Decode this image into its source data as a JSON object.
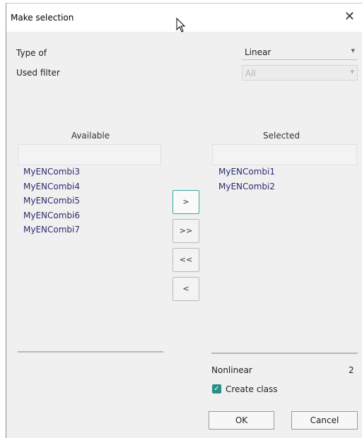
{
  "window": {
    "title": "Make selection",
    "close_glyph": "✕"
  },
  "form": {
    "type_label": "Type of",
    "type_value": "Linear",
    "filter_label": "Used filter",
    "filter_value": "All"
  },
  "available": {
    "header": "Available",
    "items": [
      "MyENCombi3",
      "MyENCombi4",
      "MyENCombi5",
      "MyENCombi6",
      "MyENCombi7"
    ]
  },
  "selected": {
    "header": "Selected",
    "items": [
      "MyENCombi1",
      "MyENCombi2"
    ]
  },
  "transfer": {
    "add_one": ">",
    "add_all": ">>",
    "remove_all": "<<",
    "remove_one": "<"
  },
  "summary": {
    "label": "Nonlinear",
    "count": "2"
  },
  "options": {
    "create_class_label": "Create class",
    "create_class_checked": true
  },
  "actions": {
    "ok": "OK",
    "cancel": "Cancel"
  },
  "colors": {
    "accent": "#2a8f86",
    "item_text": "#2b2b6e"
  }
}
